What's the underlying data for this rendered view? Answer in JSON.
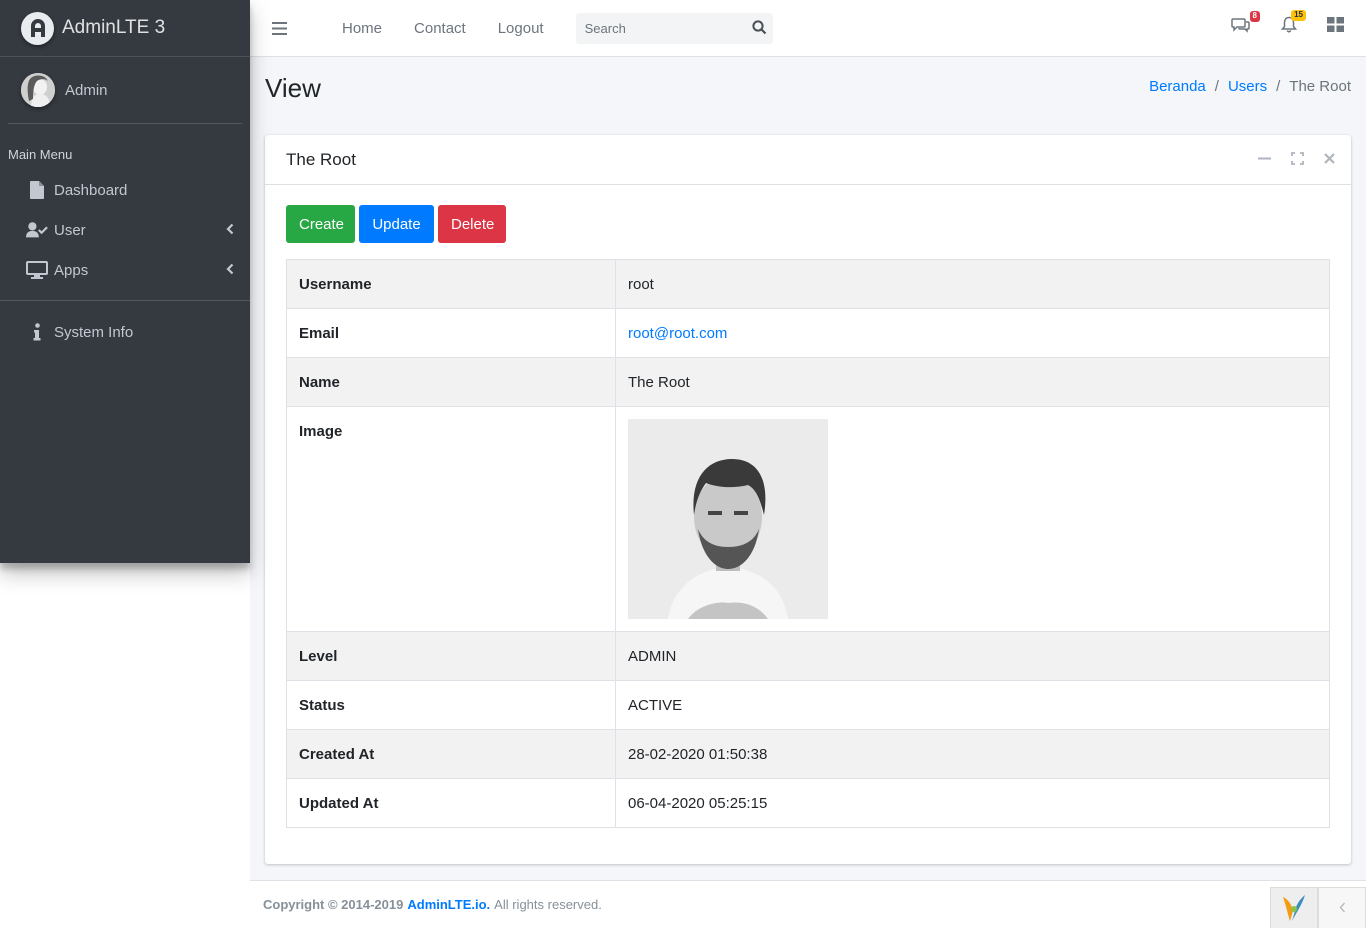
{
  "brand": {
    "name": "AdminLTE 3"
  },
  "user_panel": {
    "name": "Admin"
  },
  "sidebar": {
    "header": "Main Menu",
    "items": [
      {
        "label": "Dashboard",
        "icon": "file-icon"
      },
      {
        "label": "User",
        "icon": "user-check-icon"
      },
      {
        "label": "Apps",
        "icon": "desktop-icon"
      },
      {
        "label": "System Info",
        "icon": "info-icon"
      }
    ]
  },
  "navbar": {
    "links": [
      "Home",
      "Contact",
      "Logout"
    ],
    "search_placeholder": "Search",
    "messages_count": "8",
    "notifications_count": "15"
  },
  "page": {
    "title": "View",
    "breadcrumb": [
      "Beranda",
      "Users",
      "The Root"
    ]
  },
  "card": {
    "title": "The Root",
    "buttons": {
      "create": "Create",
      "update": "Update",
      "delete": "Delete"
    },
    "rows": [
      {
        "label": "Username",
        "value": "root"
      },
      {
        "label": "Email",
        "value": "root@root.com"
      },
      {
        "label": "Name",
        "value": "The Root"
      },
      {
        "label": "Image",
        "value": ""
      },
      {
        "label": "Level",
        "value": "ADMIN"
      },
      {
        "label": "Status",
        "value": "ACTIVE"
      },
      {
        "label": "Created At",
        "value": "28-02-2020 01:50:38"
      },
      {
        "label": "Updated At",
        "value": "06-04-2020 05:25:15"
      }
    ]
  },
  "footer": {
    "copyright": "Copyright © 2014-2019",
    "link": "AdminLTE.io.",
    "rights": "All rights reserved."
  },
  "colors": {
    "sidebar_bg": "#343a40",
    "primary": "#007bff",
    "success": "#28a745",
    "danger": "#dc3545",
    "warning": "#ffc107"
  }
}
